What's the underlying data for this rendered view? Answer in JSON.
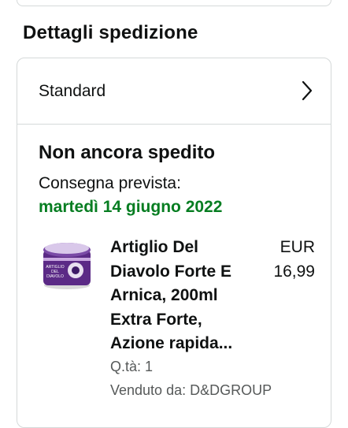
{
  "shipping_section": {
    "title": "Dettagli spedizione",
    "method": "Standard",
    "status": "Non ancora spedito",
    "delivery_label": "Consegna prevista:",
    "delivery_date": "martedì 14 giugno 2022"
  },
  "item": {
    "name_lines": [
      "Artiglio Del",
      "Diavolo Forte E",
      "Arnica, 200ml",
      "Extra Forte,",
      "Azione rapida..."
    ],
    "price_currency": "EUR",
    "price_amount": "16,99",
    "quantity": "Q.tà: 1",
    "seller": "Venduto da: D&DGROUP",
    "image_text": [
      "ARTIGLIO",
      "DEL",
      "DIAVOLO"
    ]
  },
  "colors": {
    "delivery_green": "#067d21",
    "border": "#d5d9d9",
    "secondary_text": "#565959",
    "jar_purple": "#5b2a86"
  },
  "icons": {
    "method_chevron": "chevron-right-icon"
  }
}
